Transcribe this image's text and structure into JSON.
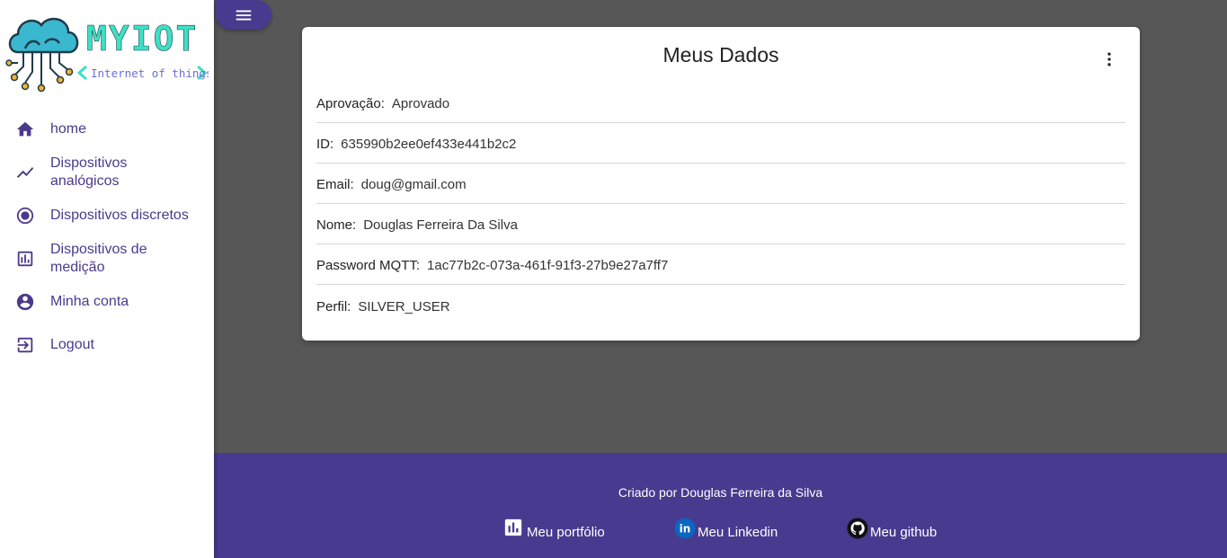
{
  "brand": {
    "name": "MYIOT",
    "tagline": "Internet of things",
    "colors": {
      "title": "#3de0c4",
      "tagline": "#6a6fd6",
      "cloud": "#3ab8cf"
    }
  },
  "sidebar": {
    "items": [
      {
        "label": "home",
        "icon": "home-icon"
      },
      {
        "label": "Dispositivos analógicos",
        "icon": "trending-up-icon"
      },
      {
        "label": "Dispositivos discretos",
        "icon": "radio-button-icon"
      },
      {
        "label": "Dispositivos de medição",
        "icon": "bar-chart-box-icon"
      },
      {
        "label": "Minha conta",
        "icon": "account-circle-icon"
      },
      {
        "label": "Logout",
        "icon": "logout-icon"
      }
    ]
  },
  "menu_toggle": {
    "icon": "hamburger-menu-icon"
  },
  "card": {
    "title": "Meus Dados",
    "rows": [
      {
        "key": "Aprovação:",
        "value": "Aprovado"
      },
      {
        "key": "ID:",
        "value": "635990b2ee0ef433e441b2c2"
      },
      {
        "key": "Email:",
        "value": "doug@gmail.com"
      },
      {
        "key": "Nome:",
        "value": "Douglas Ferreira Da Silva"
      },
      {
        "key": "Password MQTT:",
        "value": "1ac77b2c-073a-461f-91f3-27b9e27a7ff7"
      },
      {
        "key": "Perfil:",
        "value": "SILVER_USER"
      }
    ]
  },
  "footer": {
    "credit": "Criado por Douglas Ferreira da Silva",
    "links": [
      {
        "label": "Meu portfólio",
        "icon": "bar-chart-icon"
      },
      {
        "label": "Meu Linkedin",
        "icon": "linkedin-icon"
      },
      {
        "label": "Meu github",
        "icon": "github-icon"
      }
    ]
  },
  "colors": {
    "primary": "#483a8e",
    "background": "#575757",
    "nav_text": "#4a3a8c"
  }
}
